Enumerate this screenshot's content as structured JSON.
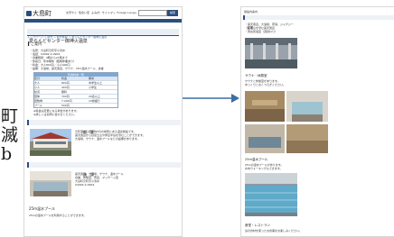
{
  "left_page": {
    "logo_text": "大島町",
    "header_links": [
      "文字サイズ",
      "色合い変更",
      "よみがな",
      "サイトマップ",
      "Foreign Language"
    ],
    "search_label": "検索",
    "breadcrumb": "トップページ > 観光 > 観光施設 > 愛らんどセンター御神火温泉",
    "page_title": "愛らんどセンター御神火温泉",
    "section_heading": "▍ご案内",
    "info_lines": [
      "・住所：大島町元町字小清水",
      "・電話：04992-2-0909",
      "・営業時間：9時から21時まで",
      "・休館日：年中無休（臨時休業あり）",
      "・料金：大人800円／小人400円",
      "・設備：大浴場、露天風呂、サウナ、25m温水プール、食堂"
    ],
    "table_title": "利用料金一覧",
    "table_headers": [
      "区分",
      "料金",
      "備考"
    ],
    "table_rows": [
      [
        "大人",
        "800円",
        "中学生以上"
      ],
      [
        "小人",
        "400円",
        "小学生"
      ],
      [
        "幼児",
        "無料",
        ""
      ],
      [
        "団体",
        "700円",
        "20名以上"
      ],
      [
        "回数券",
        "7,200円",
        "10枚綴り"
      ],
      [
        "プール",
        "500円",
        ""
      ]
    ],
    "notes": [
      "※料金は変更になる場合があります。",
      "※詳しくはお問い合わせください。"
    ],
    "overview_heading": "概　要",
    "overview_text": [
      "元町港から徒歩約5分の場所にある温泉施設です。",
      "露天風呂からは富士山や伊豆半島を望むことができます。",
      "大浴場、サウナ、温水プールなどの設備があります。"
    ],
    "facility_heading": "施　設",
    "facility_text": [
      "露天風呂、大浴場、サウナ、温水プール",
      "食堂、休憩室、売店、マッサージ室",
      "大島町元町字小清水",
      "04992-2-0909"
    ],
    "pool_heading": "25m温水プール",
    "pool_text": [
      "25mの温水プールを利用することができます。"
    ]
  },
  "side_text": [
    "町",
    "滅",
    "b"
  ],
  "right_page": {
    "top_label": "施設内案内",
    "bath_heading": "浴場",
    "bath_text": [
      "・露天風呂、大浴場、寝湯、ジャグジー",
      "・富士山を望む露天風呂",
      "・男女別浴室（週替わり）"
    ],
    "sauna_heading": "サウナ・休憩室",
    "sauna_text": [
      "サウナと休憩室があります。",
      "ゆっくりとおくつろぎください。"
    ],
    "pool_heading": "25m温水プール",
    "pool_text": [
      "25mの温水プールがあります。",
      "水中ウォーキングもできます。"
    ],
    "restaurant_heading": "食堂・レストラン",
    "restaurant_text": [
      "島の食材を使ったお食事をお楽しみください。"
    ]
  },
  "colors": {
    "accent": "#2a4f7f",
    "arrow": "#3a6ea5",
    "table_header": "#7ea8d3"
  }
}
